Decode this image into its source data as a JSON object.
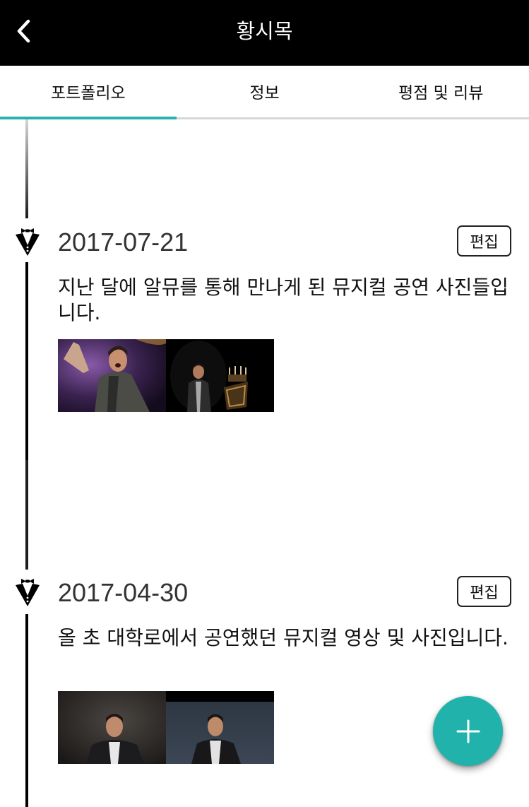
{
  "header": {
    "title": "황시목",
    "back_icon": "chevron-left-icon"
  },
  "tabs": [
    {
      "label": "포트폴리오",
      "active": true
    },
    {
      "label": "정보",
      "active": false
    },
    {
      "label": "평점 및 리뷰",
      "active": false
    }
  ],
  "accent_color": "#26b3ac",
  "entries": [
    {
      "date": "2017-07-21",
      "edit_label": "편집",
      "description": "지난 달에 알뮤를 통해 만나게 된 뮤지컬 공연 사진들입니다.",
      "icon": "tuxedo-icon",
      "photo_count": 2
    },
    {
      "date": "2017-04-30",
      "edit_label": "편집",
      "description": "올 초 대학로에서 공연했던 뮤지컬 영상 및 사진입니다.",
      "icon": "tuxedo-icon",
      "photo_count": 2
    }
  ],
  "fab": {
    "icon": "plus-icon",
    "color": "#21b3ab"
  }
}
